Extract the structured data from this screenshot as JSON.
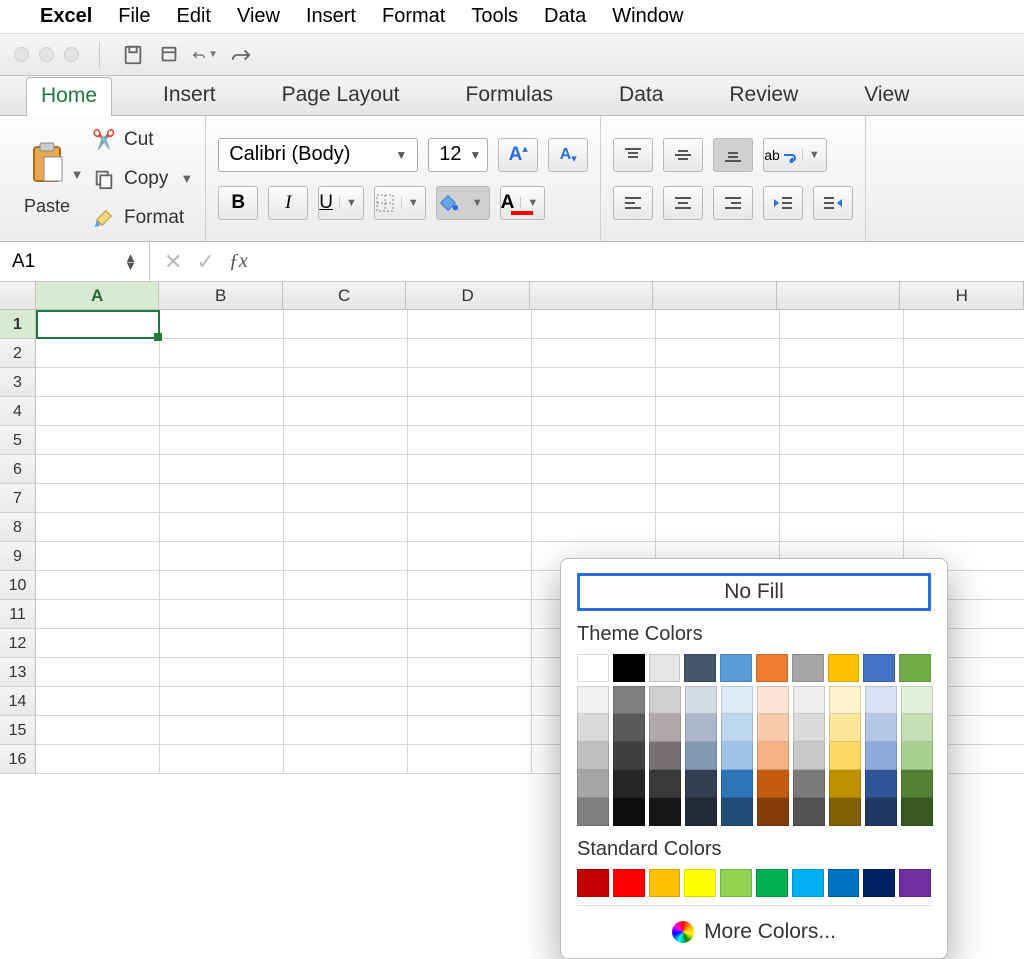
{
  "menubar": {
    "app": "Excel",
    "items": [
      "File",
      "Edit",
      "View",
      "Insert",
      "Format",
      "Tools",
      "Data",
      "Window"
    ]
  },
  "ribbon_tabs": [
    "Home",
    "Insert",
    "Page Layout",
    "Formulas",
    "Data",
    "Review",
    "View"
  ],
  "active_tab": "Home",
  "clipboard": {
    "paste": "Paste",
    "cut": "Cut",
    "copy": "Copy",
    "format": "Format"
  },
  "font": {
    "name": "Calibri (Body)",
    "size": "12"
  },
  "namebox": "A1",
  "columns": [
    "A",
    "B",
    "C",
    "D",
    "",
    "",
    "",
    "H"
  ],
  "row_count": 16,
  "selection": {
    "col": 0,
    "row": 0
  },
  "picker": {
    "no_fill": "No Fill",
    "theme_label": "Theme Colors",
    "standard_label": "Standard Colors",
    "more": "More Colors...",
    "theme": [
      "#ffffff",
      "#000000",
      "#e7e6e6",
      "#44546a",
      "#5b9bd5",
      "#ed7d31",
      "#a5a5a5",
      "#ffc000",
      "#4472c4",
      "#70ad47"
    ],
    "theme_tints": [
      [
        "#f2f2f2",
        "#d9d9d9",
        "#bfbfbf",
        "#a6a6a6",
        "#808080"
      ],
      [
        "#7f7f7f",
        "#595959",
        "#404040",
        "#262626",
        "#0d0d0d"
      ],
      [
        "#d0cece",
        "#aeaaaa",
        "#757171",
        "#3a3838",
        "#161616"
      ],
      [
        "#d6dce5",
        "#adb9ca",
        "#8497b0",
        "#333f50",
        "#222a35"
      ],
      [
        "#deebf7",
        "#bdd7ee",
        "#9dc3e6",
        "#2e75b6",
        "#1f4e79"
      ],
      [
        "#fbe5d6",
        "#f8cbad",
        "#f4b183",
        "#c55a11",
        "#843c0c"
      ],
      [
        "#ededed",
        "#dbdbdb",
        "#c9c9c9",
        "#7b7b7b",
        "#525252"
      ],
      [
        "#fff2cc",
        "#ffe699",
        "#ffd966",
        "#bf9000",
        "#806000"
      ],
      [
        "#d9e2f3",
        "#b4c7e7",
        "#8faadc",
        "#2f5597",
        "#203864"
      ],
      [
        "#e2f0d9",
        "#c5e0b4",
        "#a9d18e",
        "#548235",
        "#385723"
      ]
    ],
    "standard": [
      "#c00000",
      "#ff0000",
      "#ffc000",
      "#ffff00",
      "#92d050",
      "#00b050",
      "#00b0f0",
      "#0070c0",
      "#002060",
      "#7030a0"
    ]
  }
}
